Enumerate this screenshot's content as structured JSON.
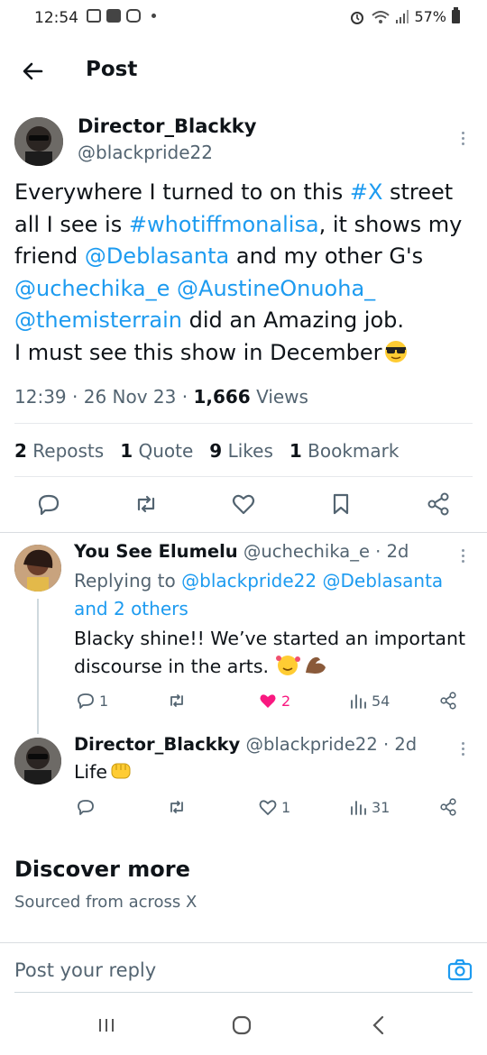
{
  "status_bar": {
    "time": "12:54",
    "battery": "57%",
    "icons": [
      "gallery-icon",
      "youtube-icon",
      "instagram-icon",
      "alarm-icon",
      "wifi-icon",
      "signal-icon",
      "battery-icon"
    ]
  },
  "header": {
    "title": "Post"
  },
  "post": {
    "author_name": "Director_Blackky",
    "author_handle": "@blackpride22",
    "text": {
      "p1": "Everywhere I turned to on this ",
      "hashtag1": "#X",
      "p2": " street all I see is ",
      "hashtag2": "#whotiffmonalisa",
      "p3": ", it shows my friend ",
      "mention1": "@Deblasanta",
      "p4": " and my other G's ",
      "mention2": "@uchechika_e",
      "mention3": "@AustineOnuoha_",
      "mention4": "@themisterrain",
      "p5": " did an Amazing job.",
      "p6": "I must see this show in December"
    },
    "time": "12:39",
    "date": "26 Nov 23",
    "views_count": "1,666",
    "views_label": "Views",
    "stats": {
      "reposts_count": "2",
      "reposts_label": "Reposts",
      "quotes_count": "1",
      "quotes_label": "Quote",
      "likes_count": "9",
      "likes_label": "Likes",
      "bookmarks_count": "1",
      "bookmarks_label": "Bookmark"
    }
  },
  "replies": [
    {
      "name": "You See Elumelu",
      "handle": "@uchechika_e",
      "age": "2d",
      "replying_prefix": "Replying to ",
      "replying_to_1": "@blackpride22",
      "replying_to_2": "@Deblasanta",
      "replying_others": "and 2 others",
      "text": "Blacky shine!! We’ve started an important discourse in the arts.",
      "reply_count": "1",
      "like_count": "2",
      "view_count": "54"
    },
    {
      "name": "Director_Blackky",
      "handle": "@blackpride22",
      "age": "2d",
      "text": "Life",
      "like_count": "1",
      "view_count": "31"
    }
  ],
  "discover": {
    "title": "Discover more",
    "subtitle": "Sourced from across X"
  },
  "reply_box": {
    "placeholder": "Post your reply"
  },
  "colors": {
    "link": "#1d9bf0",
    "like_active": "#f91880",
    "text": "#0f1419",
    "muted": "#536471"
  }
}
